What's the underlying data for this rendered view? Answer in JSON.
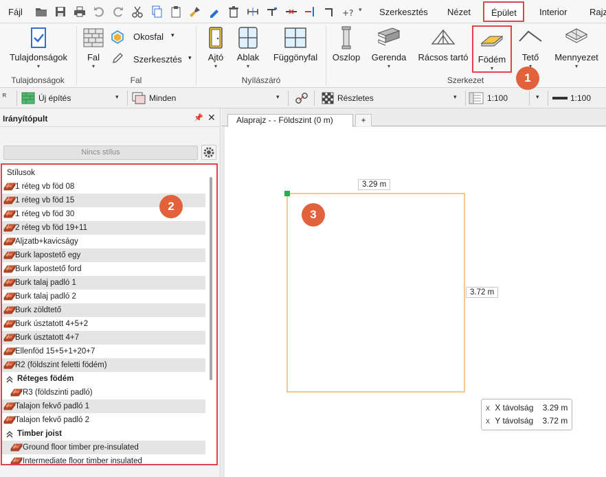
{
  "menu": {
    "file": "Fájl",
    "items": [
      "Szerkesztés",
      "Nézet",
      "Épület",
      "Interior",
      "Rajz"
    ],
    "active": "Épület"
  },
  "ribbon": {
    "properties": "Tulajdonságok",
    "wall": "Fal",
    "smart_wall": "Okosfal",
    "edit": "Szerkesztés",
    "door": "Ajtó",
    "window": "Ablak",
    "curtain_wall": "Függönyfal",
    "column": "Oszlop",
    "beam": "Gerenda",
    "truss": "Rácsos tartó",
    "slab": "Födém",
    "roof": "Tető",
    "ceiling": "Mennyezet",
    "groups": {
      "properties": "Tulajdonságok",
      "wall": "Fal",
      "openings": "Nyílászáró",
      "structure": "Szerkezet"
    }
  },
  "propbar": {
    "phase": "Új építés",
    "layer": "Minden",
    "detail": "Részletes",
    "scale": "1:100",
    "line_scale": "1:100"
  },
  "panel": {
    "title": "Irányítópult",
    "style_button": "Nincs stílus",
    "list_header": "Stílusok",
    "items": [
      {
        "label": "1 réteg vb föd 08",
        "kind": "item",
        "alt": false
      },
      {
        "label": "1 réteg vb föd 15",
        "kind": "item",
        "alt": true
      },
      {
        "label": "1 réteg vb föd 30",
        "kind": "item",
        "alt": false
      },
      {
        "label": "2 réteg vb föd 19+11",
        "kind": "item",
        "alt": true
      },
      {
        "label": "Aljzatb+kavicságy",
        "kind": "item",
        "alt": false
      },
      {
        "label": "Burk lapostető egy",
        "kind": "item",
        "alt": true
      },
      {
        "label": "Burk lapostető ford",
        "kind": "item",
        "alt": false
      },
      {
        "label": "Burk talaj padló 1",
        "kind": "item",
        "alt": true
      },
      {
        "label": "Burk talaj padló 2",
        "kind": "item",
        "alt": false
      },
      {
        "label": "Burk zöldtető",
        "kind": "item",
        "alt": true
      },
      {
        "label": "Burk úsztatott 4+5+2",
        "kind": "item",
        "alt": false
      },
      {
        "label": "Burk úsztatott 4+7",
        "kind": "item",
        "alt": true
      },
      {
        "label": "Ellenföd 15+5+1+20+7",
        "kind": "item",
        "alt": false
      },
      {
        "label": "R2 (földszint feletti födém)",
        "kind": "item",
        "alt": true
      },
      {
        "label": "Réteges födém",
        "kind": "head",
        "alt": false
      },
      {
        "label": "R3 (földszinti padló)",
        "kind": "indent",
        "alt": false
      },
      {
        "label": "Talajon fekvő padló 1",
        "kind": "item",
        "alt": true
      },
      {
        "label": "Talajon fekvő padló 2",
        "kind": "item",
        "alt": false
      },
      {
        "label": "Timber joist",
        "kind": "head",
        "alt": false
      },
      {
        "label": "Ground floor timber pre-insulated",
        "kind": "indent",
        "alt": true
      },
      {
        "label": "Intermediate floor timber insulated",
        "kind": "indent",
        "alt": false
      }
    ]
  },
  "canvas": {
    "tab_label": "Alaprajz -  - Földszint (0 m)",
    "tab_add": "+",
    "width_label": "3.29 m",
    "height_label": "3.72 m",
    "coords": {
      "x_label": "X távolság",
      "x_value": "3.29 m",
      "y_label": "Y távolság",
      "y_value": "3.72 m"
    }
  },
  "callouts": [
    "1",
    "2",
    "3"
  ],
  "colors": {
    "highlight_red": "#e0434a",
    "callout_orange": "#e2623c",
    "slab_outline": "#f0b46e",
    "start_marker": "#1fb34a"
  }
}
